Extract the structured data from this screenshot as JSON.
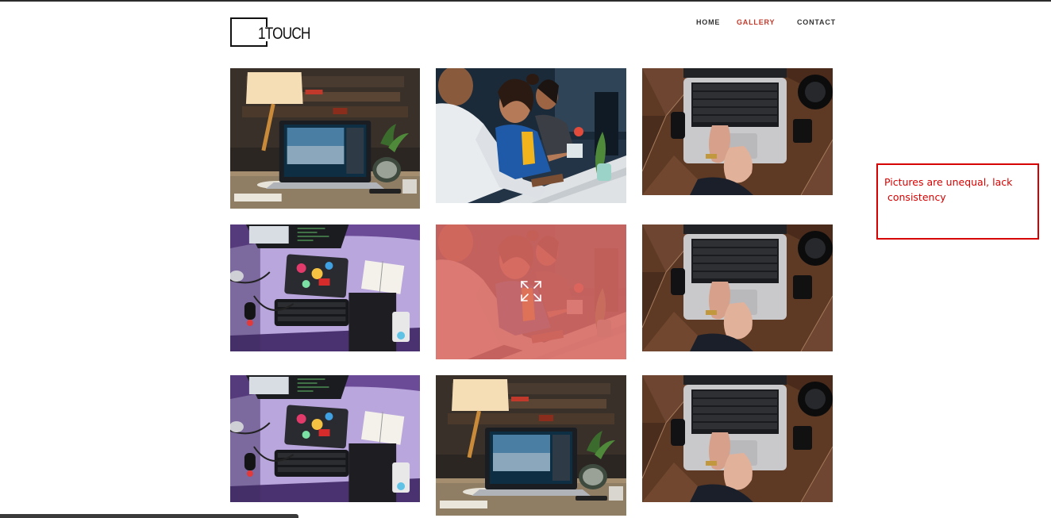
{
  "brand": {
    "logo_text": "1TOUCH"
  },
  "nav": {
    "items": [
      {
        "label": "HOME",
        "active": false
      },
      {
        "label": "GALLERY",
        "active": true
      },
      {
        "label": "CONTACT",
        "active": false
      }
    ],
    "active_color": "#c0392b"
  },
  "gallery": {
    "tiles": [
      {
        "photo": "laptop-desk-lamp"
      },
      {
        "photo": "office-team-smiling"
      },
      {
        "photo": "laptop-typing-top-view"
      },
      {
        "photo": "purple-desk-top-view"
      },
      {
        "photo": "office-team-smiling",
        "hover_overlay": true,
        "overlay_icon": "expand-icon",
        "overlay_color": "#da6962"
      },
      {
        "photo": "laptop-typing-top-view"
      },
      {
        "photo": "purple-desk-top-view"
      },
      {
        "photo": "laptop-desk-lamp"
      },
      {
        "photo": "laptop-typing-top-view"
      }
    ]
  },
  "annotation": {
    "text": "Pictures are unequal, lack\n consistency",
    "color": "#d60000"
  }
}
